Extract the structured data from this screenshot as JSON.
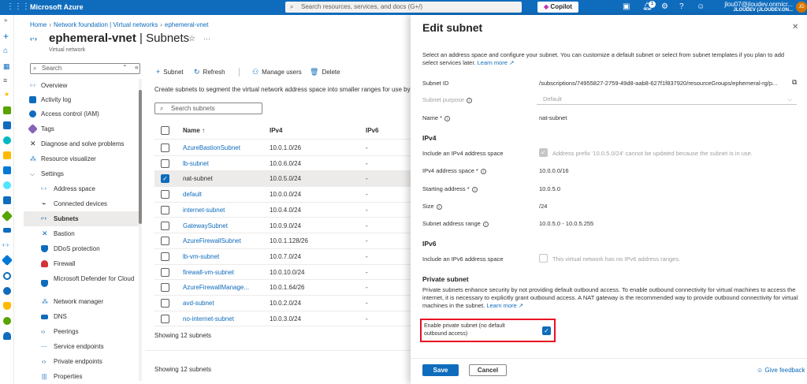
{
  "topbar": {
    "brand": "Microsoft Azure",
    "search_placeholder": "Search resources, services, and docs (G+/)",
    "copilot_label": "Copilot",
    "notification_count": "1",
    "user_name": "jlou07@jloudev.onmicr...",
    "user_directory": "JLOUDEV (JLOUDEV.ON...",
    "avatar_initials": "JD"
  },
  "breadcrumb": [
    "Home",
    "Network foundation | Virtual networks",
    "ephemeral-vnet"
  ],
  "page": {
    "title_resource": "ephemeral-vnet",
    "title_section": "Subnets",
    "subtitle": "Virtual network"
  },
  "nav": {
    "search_placeholder": "Search",
    "items": [
      {
        "label": "Overview",
        "icon": "vnet-icon",
        "color": "#0f6cbd"
      },
      {
        "label": "Activity log",
        "icon": "activity-log-icon",
        "color": "#0f6cbd"
      },
      {
        "label": "Access control (IAM)",
        "icon": "iam-icon",
        "color": "#0f6cbd"
      },
      {
        "label": "Tags",
        "icon": "tag-icon",
        "color": "#8764b8"
      },
      {
        "label": "Diagnose and solve problems",
        "icon": "wrench-icon",
        "color": "#605e5c"
      },
      {
        "label": "Resource visualizer",
        "icon": "visualizer-icon",
        "color": "#0f6cbd"
      },
      {
        "label": "Settings",
        "icon": "chevron-down-icon",
        "color": "#605e5c"
      },
      {
        "label": "Address space",
        "icon": "address-space-icon",
        "color": "#0f6cbd"
      },
      {
        "label": "Connected devices",
        "icon": "plug-icon",
        "color": "#323130"
      },
      {
        "label": "Subnets",
        "icon": "subnets-icon",
        "color": "#0f6cbd"
      },
      {
        "label": "Bastion",
        "icon": "bastion-icon",
        "color": "#0f6cbd"
      },
      {
        "label": "DDoS protection",
        "icon": "shield-icon",
        "color": "#0f6cbd"
      },
      {
        "label": "Firewall",
        "icon": "firewall-icon",
        "color": "#d13438"
      },
      {
        "label": "Microsoft Defender for Cloud",
        "icon": "defender-icon",
        "color": "#0f6cbd"
      },
      {
        "label": "Network manager",
        "icon": "network-manager-icon",
        "color": "#0f6cbd"
      },
      {
        "label": "DNS",
        "icon": "dns-icon",
        "color": "#0f6cbd"
      },
      {
        "label": "Peerings",
        "icon": "peerings-icon",
        "color": "#0f6cbd"
      },
      {
        "label": "Service endpoints",
        "icon": "service-endpoints-icon",
        "color": "#0f6cbd"
      },
      {
        "label": "Private endpoints",
        "icon": "private-endpoints-icon",
        "color": "#0f6cbd"
      },
      {
        "label": "Properties",
        "icon": "properties-icon",
        "color": "#0f6cbd"
      }
    ]
  },
  "toolbar": {
    "add_subnet": "Subnet",
    "refresh": "Refresh",
    "manage_users": "Manage users",
    "delete": "Delete"
  },
  "subnets": {
    "description": "Create subnets to segment the virtual network address space into smaller ranges for use by your",
    "search_placeholder": "Search subnets",
    "columns": {
      "name": "Name",
      "ipv4": "IPv4",
      "ipv6": "IPv6"
    },
    "sort_indicator": "↑",
    "rows": [
      {
        "name": "AzureBastionSubnet",
        "ipv4": "10.0.1.0/26",
        "ipv6": "-",
        "selected": false
      },
      {
        "name": "lb-subnet",
        "ipv4": "10.0.6.0/24",
        "ipv6": "-",
        "selected": false
      },
      {
        "name": "nat-subnet",
        "ipv4": "10.0.5.0/24",
        "ipv6": "-",
        "selected": true
      },
      {
        "name": "default",
        "ipv4": "10.0.0.0/24",
        "ipv6": "-",
        "selected": false
      },
      {
        "name": "internet-subnet",
        "ipv4": "10.0.4.0/24",
        "ipv6": "-",
        "selected": false
      },
      {
        "name": "GatewaySubnet",
        "ipv4": "10.0.9.0/24",
        "ipv6": "-",
        "selected": false
      },
      {
        "name": "AzureFirewallSubnet",
        "ipv4": "10.0.1.128/26",
        "ipv6": "-",
        "selected": false
      },
      {
        "name": "lb-vm-subnet",
        "ipv4": "10.0.7.0/24",
        "ipv6": "-",
        "selected": false
      },
      {
        "name": "firewall-vm-subnet",
        "ipv4": "10.0.10.0/24",
        "ipv6": "-",
        "selected": false
      },
      {
        "name": "AzureFirewallManage...",
        "ipv4": "10.0.1.64/26",
        "ipv6": "-",
        "selected": false
      },
      {
        "name": "avd-subnet",
        "ipv4": "10.0.2.0/24",
        "ipv6": "-",
        "selected": false
      },
      {
        "name": "no-internet-subnet",
        "ipv4": "10.0.3.0/24",
        "ipv6": "-",
        "selected": false
      }
    ],
    "showing_text": "Showing 12 subnets"
  },
  "blade": {
    "title": "Edit subnet",
    "intro": "Select an address space and configure your subnet. You can customize a default subnet or select from subnet templates if you plan to add select services later.",
    "learn_more": "Learn more",
    "subnet_id_label": "Subnet ID",
    "subnet_id_value": "/subscriptions/74955827-2759-49d8-aab8-627f1f837920/resourceGroups/ephemeral-rg/p...",
    "subnet_purpose_label": "Subnet purpose",
    "subnet_purpose_value": "Default",
    "name_label": "Name *",
    "name_value": "nat-subnet",
    "ipv4_heading": "IPv4",
    "include_ipv4_label": "Include an IPv4 address space",
    "include_ipv4_note": "Address prefix '10.0.5.0/24' cannot be updated because the subnet is in use.",
    "ipv4_space_label": "IPv4 address space *",
    "ipv4_space_value": "10.0.0.0/16",
    "starting_address_label": "Starting address *",
    "starting_address_value": "10.0.5.0",
    "size_label": "Size",
    "size_value": "/24",
    "range_label": "Subnet address range",
    "range_value": "10.0.5.0 - 10.0.5.255",
    "ipv6_heading": "IPv6",
    "include_ipv6_label": "Include an IPv6 address space",
    "include_ipv6_note": "This virtual network has no IPv6 address ranges.",
    "private_heading": "Private subnet",
    "private_desc": "Private subnets enhance security by not providing default outbound access. To enable outbound connectivity for virtual machines to access the internet, it is necessary to explicitly grant outbound access. A NAT gateway is the recommended way to provide outbound connectivity for virtual machines in the subnet.",
    "private_learn_more": "Learn more",
    "private_enable_label": "Enable private subnet (no default outbound access)",
    "save": "Save",
    "cancel": "Cancel",
    "feedback": "Give feedback"
  }
}
